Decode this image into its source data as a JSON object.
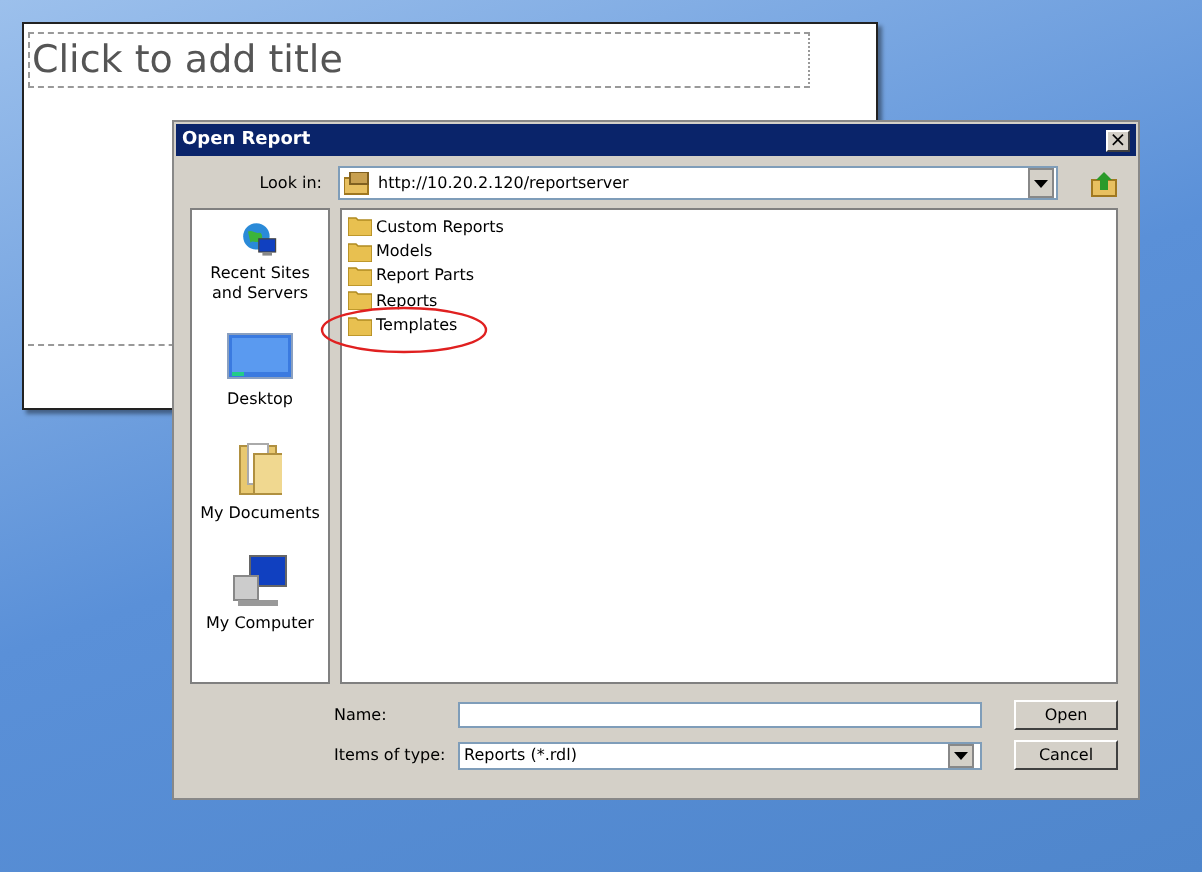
{
  "slide": {
    "title_placeholder": "Click to add title"
  },
  "dialog": {
    "title": "Open Report",
    "close": "×",
    "look_in": {
      "label": "Look in:",
      "value": "http://10.20.2.120/reportserver"
    },
    "places": [
      {
        "label": "Recent Sites and Servers",
        "kind": "globe"
      },
      {
        "label": "Desktop",
        "kind": "desktop"
      },
      {
        "label": "My Documents",
        "kind": "documents"
      },
      {
        "label": "My Computer",
        "kind": "computer"
      }
    ],
    "items": [
      {
        "name": "Custom Reports",
        "kind": "folder"
      },
      {
        "name": "Models",
        "kind": "folder"
      },
      {
        "name": "Report Parts",
        "kind": "folder"
      },
      {
        "name": "Reports",
        "kind": "folder"
      },
      {
        "name": "Templates",
        "kind": "folder",
        "circled": true
      }
    ],
    "name_field": {
      "label": "Name:"
    },
    "type_field": {
      "label": "Items of type:",
      "value": "Reports (*.rdl)"
    },
    "buttons": [
      "Open",
      "Cancel"
    ]
  }
}
